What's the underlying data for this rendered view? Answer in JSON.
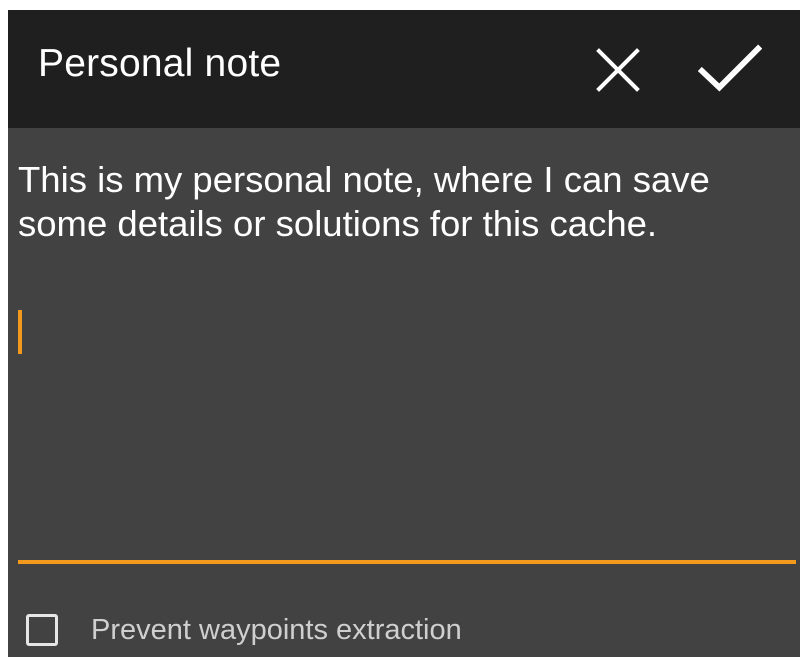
{
  "dialog": {
    "title": "Personal note",
    "actions": {
      "close_icon": "close-icon",
      "confirm_icon": "checkmark-icon"
    }
  },
  "note": {
    "text": "This is my personal note, where I can save some details or solutions for this cache."
  },
  "options": {
    "prevent_waypoints_label": "Prevent waypoints extraction",
    "prevent_waypoints_checked": false
  },
  "colors": {
    "accent": "#f39a1d",
    "titlebar_bg": "#1f1f1f",
    "content_bg": "#424242",
    "text": "#ffffff",
    "secondary_text": "#cfcfcf"
  }
}
